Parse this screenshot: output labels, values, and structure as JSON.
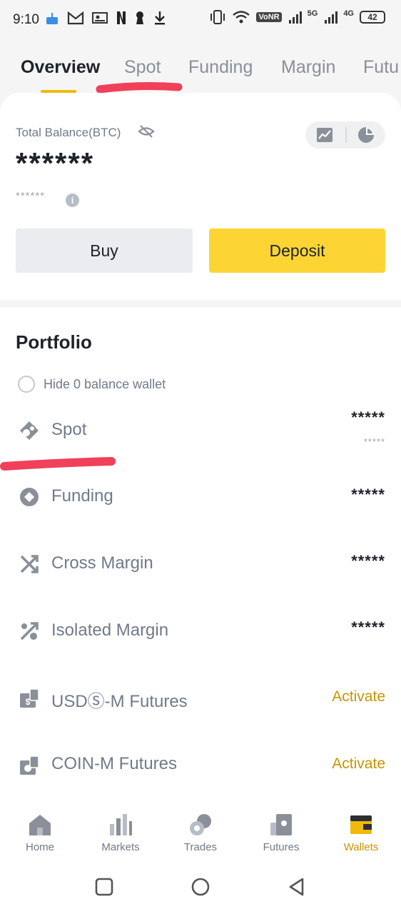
{
  "status_bar": {
    "time": "9:10",
    "left_icons": [
      "cake-icon",
      "gmail-icon",
      "image-icon",
      "netflix-icon",
      "keyhole-icon",
      "download-icon"
    ],
    "right_icons": [
      "vibrate-icon",
      "wifi-icon",
      "volte-badge",
      "signal-5g-icon",
      "signal-4g-icon",
      "battery-icon"
    ],
    "volte": "VoNR",
    "net_a": "5G",
    "net_b": "4G",
    "battery": "42"
  },
  "tabs": [
    {
      "label": "Overview",
      "active": true
    },
    {
      "label": "Spot",
      "active": false
    },
    {
      "label": "Funding",
      "active": false
    },
    {
      "label": "Margin",
      "active": false
    },
    {
      "label": "Futu",
      "active": false
    }
  ],
  "balance": {
    "label": "Total Balance(BTC)",
    "value": "******",
    "sub_value": "******"
  },
  "actions": {
    "buy_label": "Buy",
    "deposit_label": "Deposit"
  },
  "portfolio": {
    "title": "Portfolio",
    "hide_zero_label": "Hide 0 balance wallet",
    "wallets": [
      {
        "label": "Spot",
        "value": "*****",
        "sub_value": "*****",
        "icon": "spot-icon"
      },
      {
        "label": "Funding",
        "value": "*****",
        "icon": "funding-icon"
      },
      {
        "label": "Cross Margin",
        "value": "*****",
        "icon": "cross-margin-icon"
      },
      {
        "label": "Isolated Margin",
        "value": "*****",
        "icon": "isolated-margin-icon"
      },
      {
        "label": "USDⓈ-M Futures",
        "action": "Activate",
        "icon": "usds-futures-icon"
      },
      {
        "label": "COIN-M Futures",
        "action": "Activate",
        "icon": "coin-futures-icon"
      }
    ]
  },
  "bottom_nav": [
    {
      "label": "Home",
      "icon": "home-icon",
      "active": false
    },
    {
      "label": "Markets",
      "icon": "markets-icon",
      "active": false
    },
    {
      "label": "Trades",
      "icon": "trades-icon",
      "active": false
    },
    {
      "label": "Futures",
      "icon": "futures-icon",
      "active": false
    },
    {
      "label": "Wallets",
      "icon": "wallets-icon",
      "active": true
    }
  ],
  "colors": {
    "accent": "#f0b90b",
    "deposit_bg": "#fcd535",
    "activate_text": "#c99400",
    "annotation_red": "#f0405a"
  }
}
